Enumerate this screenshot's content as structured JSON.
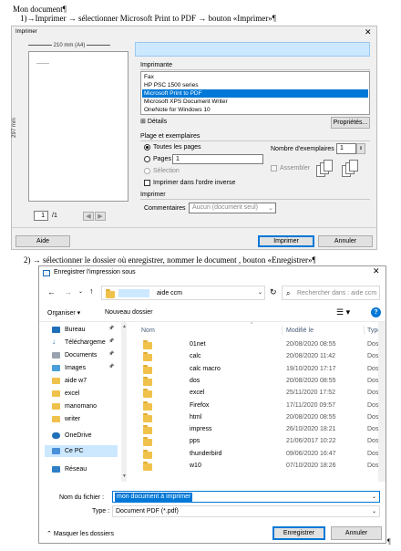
{
  "doc": {
    "title": "Mon document¶",
    "step1": "1)→Imprimer → sélectionner Microsoft Print to PDF → bouton «Imprimer»¶",
    "step2": "2) → sélectionner le dossier où enregistrer, nommer le document , bouton «Enregistrer»¶",
    "pilcrow": "¶"
  },
  "print_dialog": {
    "title": "Imprimer",
    "close": "✕",
    "paper_width": "210 mm (A4)",
    "paper_height": "297 mm",
    "page_current": "1",
    "page_total": "/1",
    "printer_section": "Imprimante",
    "printers": [
      "Fax",
      "HP PSC 1500 series",
      "Microsoft Print to PDF",
      "Microsoft XPS Document Writer",
      "OneNote for Windows 10"
    ],
    "selected_printer_index": 2,
    "details": "Détails",
    "properties": "Propriétés...",
    "range_section": "Plage et exemplaires",
    "all_pages": "Toutes les pages",
    "pages": "Pages",
    "pages_value": "1",
    "selection": "Sélection",
    "reverse": "Imprimer dans l'ordre inverse",
    "copies_label": "Nombre d'exemplaires",
    "copies_value": "1",
    "collate": "Assembler",
    "print_section": "Imprimer",
    "comments_label": "Commentaires",
    "comments_value": "Aucun (document seul)",
    "help": "Aide",
    "print": "Imprimer",
    "cancel": "Annuler"
  },
  "save_dialog": {
    "title": "Enregistrer l'impression sous",
    "close": "✕",
    "path_tail": "aide ccm",
    "search_placeholder": "Rechercher dans : aide ccm",
    "organize": "Organiser",
    "new_folder": "Nouveau dossier",
    "help": "?",
    "nav_items": [
      "Bureau",
      "Téléchargeme",
      "Documents",
      "Images",
      "aide w7",
      "excel",
      "manomano",
      "writer",
      "OneDrive",
      "Ce PC",
      "Réseau"
    ],
    "col_name": "Nom",
    "col_date": "Modifié le",
    "col_type": "Type",
    "files": [
      {
        "name": "01net",
        "date": "20/08/2020 08:55",
        "type": "Doss"
      },
      {
        "name": "calc",
        "date": "20/08/2020 11:42",
        "type": "Doss"
      },
      {
        "name": "calc macro",
        "date": "19/10/2020 17:17",
        "type": "Doss"
      },
      {
        "name": "dos",
        "date": "20/08/2020 08:55",
        "type": "Doss"
      },
      {
        "name": "excel",
        "date": "25/11/2020 17:52",
        "type": "Doss"
      },
      {
        "name": "Firefox",
        "date": "17/11/2020 09:57",
        "type": "Doss"
      },
      {
        "name": "html",
        "date": "20/08/2020 08:55",
        "type": "Doss"
      },
      {
        "name": "impress",
        "date": "26/10/2020 18:21",
        "type": "Doss"
      },
      {
        "name": "pps",
        "date": "21/06/2017 10:22",
        "type": "Doss"
      },
      {
        "name": "thunderbird",
        "date": "09/06/2020 16:47",
        "type": "Doss"
      },
      {
        "name": "w10",
        "date": "07/10/2020 18:26",
        "type": "Doss"
      }
    ],
    "filename_label": "Nom du fichier :",
    "filename_value": "mon document à imprimer",
    "type_label": "Type :",
    "type_value": "Document PDF (*.pdf)",
    "hide_folders": "Masquer les dossiers",
    "save": "Enregistrer",
    "cancel": "Annuler"
  },
  "colors": {
    "accent": "#0078d7",
    "selected": "#cce8ff",
    "folder": "#f0c24b"
  }
}
